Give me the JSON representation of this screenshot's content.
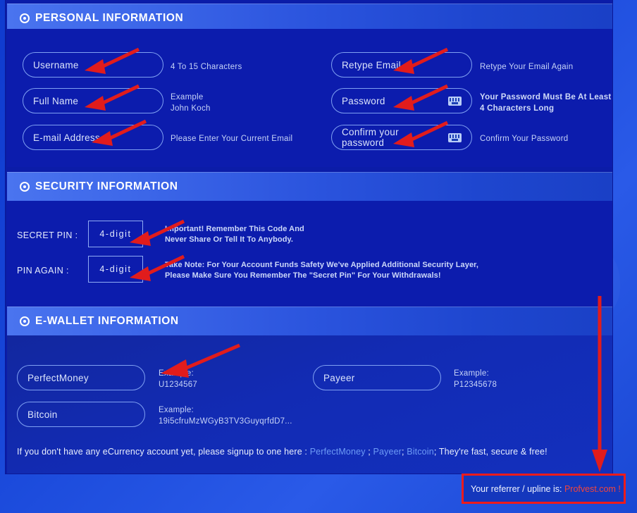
{
  "page": {
    "background_color": "#1746d8",
    "panel_color": "#0b1ca8",
    "accent_header_color": "#4a74ef",
    "link_color": "#6d9bf6",
    "annotation_color": "#ee1b1b"
  },
  "sections": [
    {
      "id": "personal",
      "icon": "circle-dot-icon",
      "title": "PERSONAL INFORMATION",
      "fields": [
        {
          "placeholder": "Username",
          "hint": [
            "4 To 15 Characters"
          ],
          "keyboard_icon": false
        },
        {
          "placeholder": "Full Name",
          "hint": [
            "Example",
            "John Koch"
          ],
          "keyboard_icon": false
        },
        {
          "placeholder": "E-mail Address",
          "hint": [
            "Please Enter Your Current Email"
          ],
          "keyboard_icon": false
        },
        {
          "placeholder": "Retype Email",
          "hint": [
            "Retype Your Email Again"
          ],
          "keyboard_icon": false
        },
        {
          "placeholder": "Password",
          "hint": [
            "Your Password Must Be At Least",
            "4 Characters Long"
          ],
          "keyboard_icon": true
        },
        {
          "placeholder": "Confirm your password",
          "hint": [
            "Confirm Your Password"
          ],
          "keyboard_icon": true
        }
      ]
    },
    {
      "id": "security",
      "icon": "circle-dot-icon",
      "title": "SECURITY INFORMATION",
      "rows": [
        {
          "label": "SECRET PIN :",
          "value": "4-digit",
          "note": [
            "Important! Remember This Code And",
            "Never Share Or Tell It To Anybody."
          ]
        },
        {
          "label": "PIN AGAIN :",
          "value": "4-digit",
          "note": [
            "Take Note: For Your Account Funds Safety We've Applied Additional Security Layer,",
            "Please Make Sure You Remember The \"Secret Pin\" For Your Withdrawals!"
          ]
        }
      ]
    },
    {
      "id": "wallet",
      "icon": "circle-dot-icon",
      "title": "E-WALLET INFORMATION",
      "fields": [
        {
          "placeholder": "PerfectMoney",
          "hint": [
            "Example:",
            "U1234567"
          ]
        },
        {
          "placeholder": "Bitcoin",
          "hint": [
            "Example:",
            "19i5cfruMzWGyB3TV3GuyqrfdD7..."
          ]
        },
        {
          "placeholder": "Payeer",
          "hint": [
            "Example:",
            "P12345678"
          ]
        }
      ]
    }
  ],
  "footer": {
    "text_before": "If you don't have any eCurrency account yet, please signup to one here : ",
    "links": [
      {
        "label": "PerfectMoney",
        "after": " ; "
      },
      {
        "label": "Payeer",
        "after": "; "
      },
      {
        "label": "Bitcoin",
        "after": "; "
      }
    ],
    "text_after": "They're fast, secure & free!"
  },
  "referrer": {
    "prefix": "Your referrer / upline is: ",
    "name": "Profvest.com !"
  },
  "annotations": {
    "count": 9,
    "description": "red arrows pointing to form inputs and referrer callout"
  }
}
